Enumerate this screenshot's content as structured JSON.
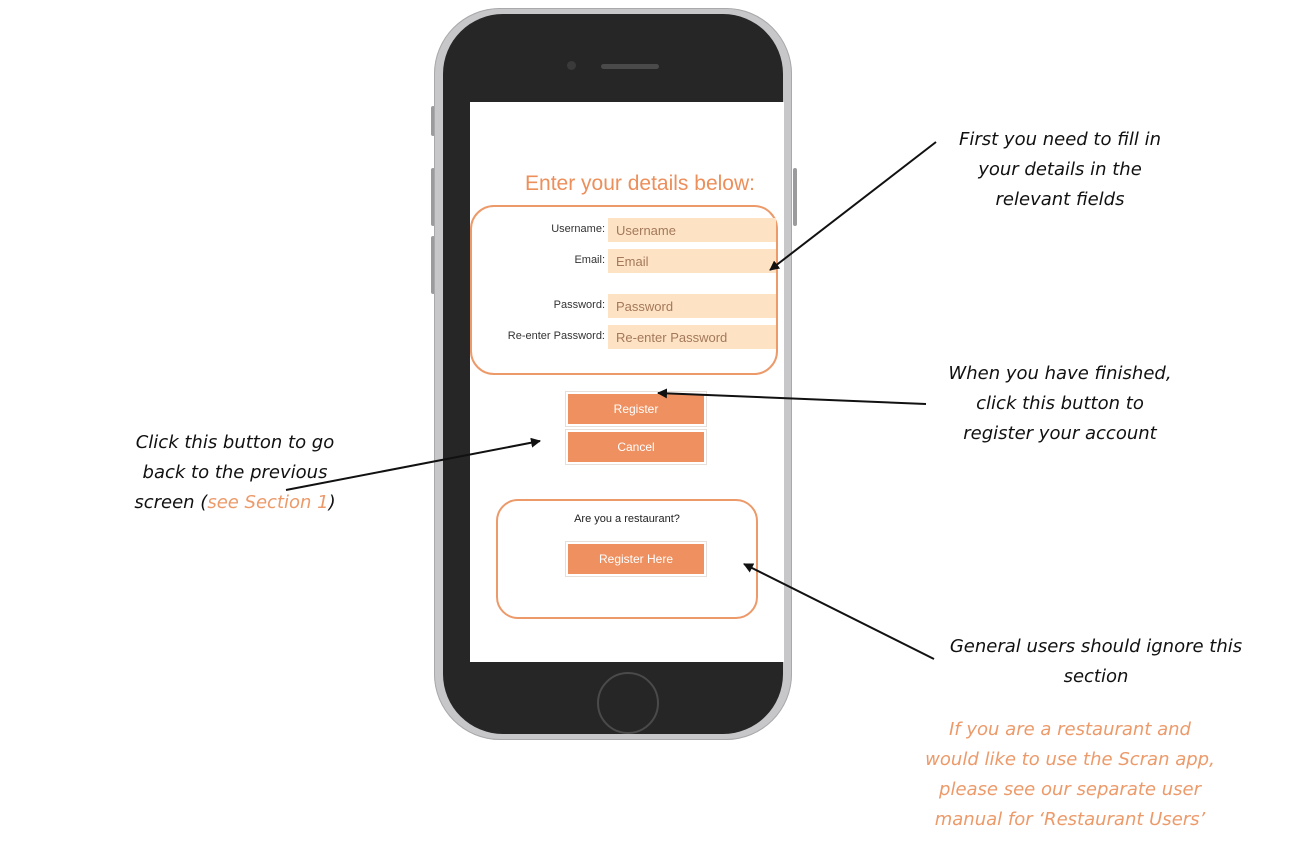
{
  "form": {
    "heading": "Enter your details below:",
    "fields": [
      {
        "label": "Username:",
        "placeholder": "Username"
      },
      {
        "label": "Email:",
        "placeholder": "Email"
      },
      {
        "label": "Password:",
        "placeholder": "Password"
      },
      {
        "label": "Re-enter Password:",
        "placeholder": "Re-enter Password"
      }
    ],
    "register_label": "Register",
    "cancel_label": "Cancel"
  },
  "restaurant": {
    "question": "Are you a restaurant?",
    "register_here_label": "Register Here"
  },
  "annotations": {
    "fill_in": [
      "First you need to fill in",
      "your details in the",
      "relevant fields"
    ],
    "finished": [
      "When you have finished,",
      "click this button to",
      "register your account"
    ],
    "cancel": {
      "line1": "Click this button to go",
      "line2": "back to the previous",
      "line3_prefix": "screen (",
      "link": "see Section 1",
      "line3_suffix": ")"
    },
    "ignore": [
      "General users should ignore this",
      "section"
    ],
    "restaurant_info": [
      "If you are a restaurant and",
      "would like to use the Scran app,",
      "please see our separate user",
      "manual for ‘Restaurant Users’"
    ]
  },
  "colors": {
    "accent": "#ee9060",
    "input_bg": "#fde3c4",
    "phone_body": "#262627",
    "annotation_highlight": "#ec9a6a"
  }
}
